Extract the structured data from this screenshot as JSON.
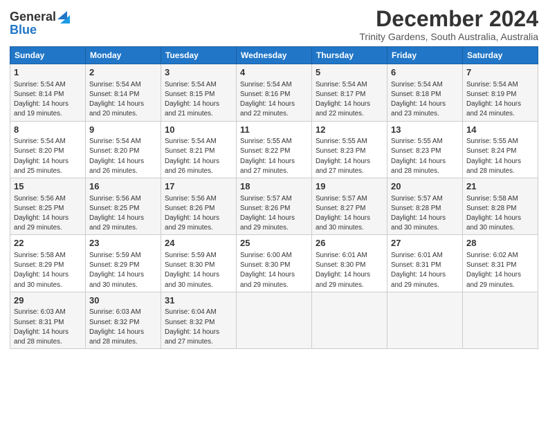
{
  "logo": {
    "line1": "General",
    "line2": "Blue"
  },
  "title": "December 2024",
  "subtitle": "Trinity Gardens, South Australia, Australia",
  "headers": [
    "Sunday",
    "Monday",
    "Tuesday",
    "Wednesday",
    "Thursday",
    "Friday",
    "Saturday"
  ],
  "weeks": [
    [
      {
        "day": "1",
        "info": "Sunrise: 5:54 AM\nSunset: 8:14 PM\nDaylight: 14 hours\nand 19 minutes."
      },
      {
        "day": "2",
        "info": "Sunrise: 5:54 AM\nSunset: 8:14 PM\nDaylight: 14 hours\nand 20 minutes."
      },
      {
        "day": "3",
        "info": "Sunrise: 5:54 AM\nSunset: 8:15 PM\nDaylight: 14 hours\nand 21 minutes."
      },
      {
        "day": "4",
        "info": "Sunrise: 5:54 AM\nSunset: 8:16 PM\nDaylight: 14 hours\nand 22 minutes."
      },
      {
        "day": "5",
        "info": "Sunrise: 5:54 AM\nSunset: 8:17 PM\nDaylight: 14 hours\nand 22 minutes."
      },
      {
        "day": "6",
        "info": "Sunrise: 5:54 AM\nSunset: 8:18 PM\nDaylight: 14 hours\nand 23 minutes."
      },
      {
        "day": "7",
        "info": "Sunrise: 5:54 AM\nSunset: 8:19 PM\nDaylight: 14 hours\nand 24 minutes."
      }
    ],
    [
      {
        "day": "8",
        "info": "Sunrise: 5:54 AM\nSunset: 8:20 PM\nDaylight: 14 hours\nand 25 minutes."
      },
      {
        "day": "9",
        "info": "Sunrise: 5:54 AM\nSunset: 8:20 PM\nDaylight: 14 hours\nand 26 minutes."
      },
      {
        "day": "10",
        "info": "Sunrise: 5:54 AM\nSunset: 8:21 PM\nDaylight: 14 hours\nand 26 minutes."
      },
      {
        "day": "11",
        "info": "Sunrise: 5:55 AM\nSunset: 8:22 PM\nDaylight: 14 hours\nand 27 minutes."
      },
      {
        "day": "12",
        "info": "Sunrise: 5:55 AM\nSunset: 8:23 PM\nDaylight: 14 hours\nand 27 minutes."
      },
      {
        "day": "13",
        "info": "Sunrise: 5:55 AM\nSunset: 8:23 PM\nDaylight: 14 hours\nand 28 minutes."
      },
      {
        "day": "14",
        "info": "Sunrise: 5:55 AM\nSunset: 8:24 PM\nDaylight: 14 hours\nand 28 minutes."
      }
    ],
    [
      {
        "day": "15",
        "info": "Sunrise: 5:56 AM\nSunset: 8:25 PM\nDaylight: 14 hours\nand 29 minutes."
      },
      {
        "day": "16",
        "info": "Sunrise: 5:56 AM\nSunset: 8:25 PM\nDaylight: 14 hours\nand 29 minutes."
      },
      {
        "day": "17",
        "info": "Sunrise: 5:56 AM\nSunset: 8:26 PM\nDaylight: 14 hours\nand 29 minutes."
      },
      {
        "day": "18",
        "info": "Sunrise: 5:57 AM\nSunset: 8:26 PM\nDaylight: 14 hours\nand 29 minutes."
      },
      {
        "day": "19",
        "info": "Sunrise: 5:57 AM\nSunset: 8:27 PM\nDaylight: 14 hours\nand 30 minutes."
      },
      {
        "day": "20",
        "info": "Sunrise: 5:57 AM\nSunset: 8:28 PM\nDaylight: 14 hours\nand 30 minutes."
      },
      {
        "day": "21",
        "info": "Sunrise: 5:58 AM\nSunset: 8:28 PM\nDaylight: 14 hours\nand 30 minutes."
      }
    ],
    [
      {
        "day": "22",
        "info": "Sunrise: 5:58 AM\nSunset: 8:29 PM\nDaylight: 14 hours\nand 30 minutes."
      },
      {
        "day": "23",
        "info": "Sunrise: 5:59 AM\nSunset: 8:29 PM\nDaylight: 14 hours\nand 30 minutes."
      },
      {
        "day": "24",
        "info": "Sunrise: 5:59 AM\nSunset: 8:30 PM\nDaylight: 14 hours\nand 30 minutes."
      },
      {
        "day": "25",
        "info": "Sunrise: 6:00 AM\nSunset: 8:30 PM\nDaylight: 14 hours\nand 29 minutes."
      },
      {
        "day": "26",
        "info": "Sunrise: 6:01 AM\nSunset: 8:30 PM\nDaylight: 14 hours\nand 29 minutes."
      },
      {
        "day": "27",
        "info": "Sunrise: 6:01 AM\nSunset: 8:31 PM\nDaylight: 14 hours\nand 29 minutes."
      },
      {
        "day": "28",
        "info": "Sunrise: 6:02 AM\nSunset: 8:31 PM\nDaylight: 14 hours\nand 29 minutes."
      }
    ],
    [
      {
        "day": "29",
        "info": "Sunrise: 6:03 AM\nSunset: 8:31 PM\nDaylight: 14 hours\nand 28 minutes."
      },
      {
        "day": "30",
        "info": "Sunrise: 6:03 AM\nSunset: 8:32 PM\nDaylight: 14 hours\nand 28 minutes."
      },
      {
        "day": "31",
        "info": "Sunrise: 6:04 AM\nSunset: 8:32 PM\nDaylight: 14 hours\nand 27 minutes."
      },
      null,
      null,
      null,
      null
    ]
  ]
}
